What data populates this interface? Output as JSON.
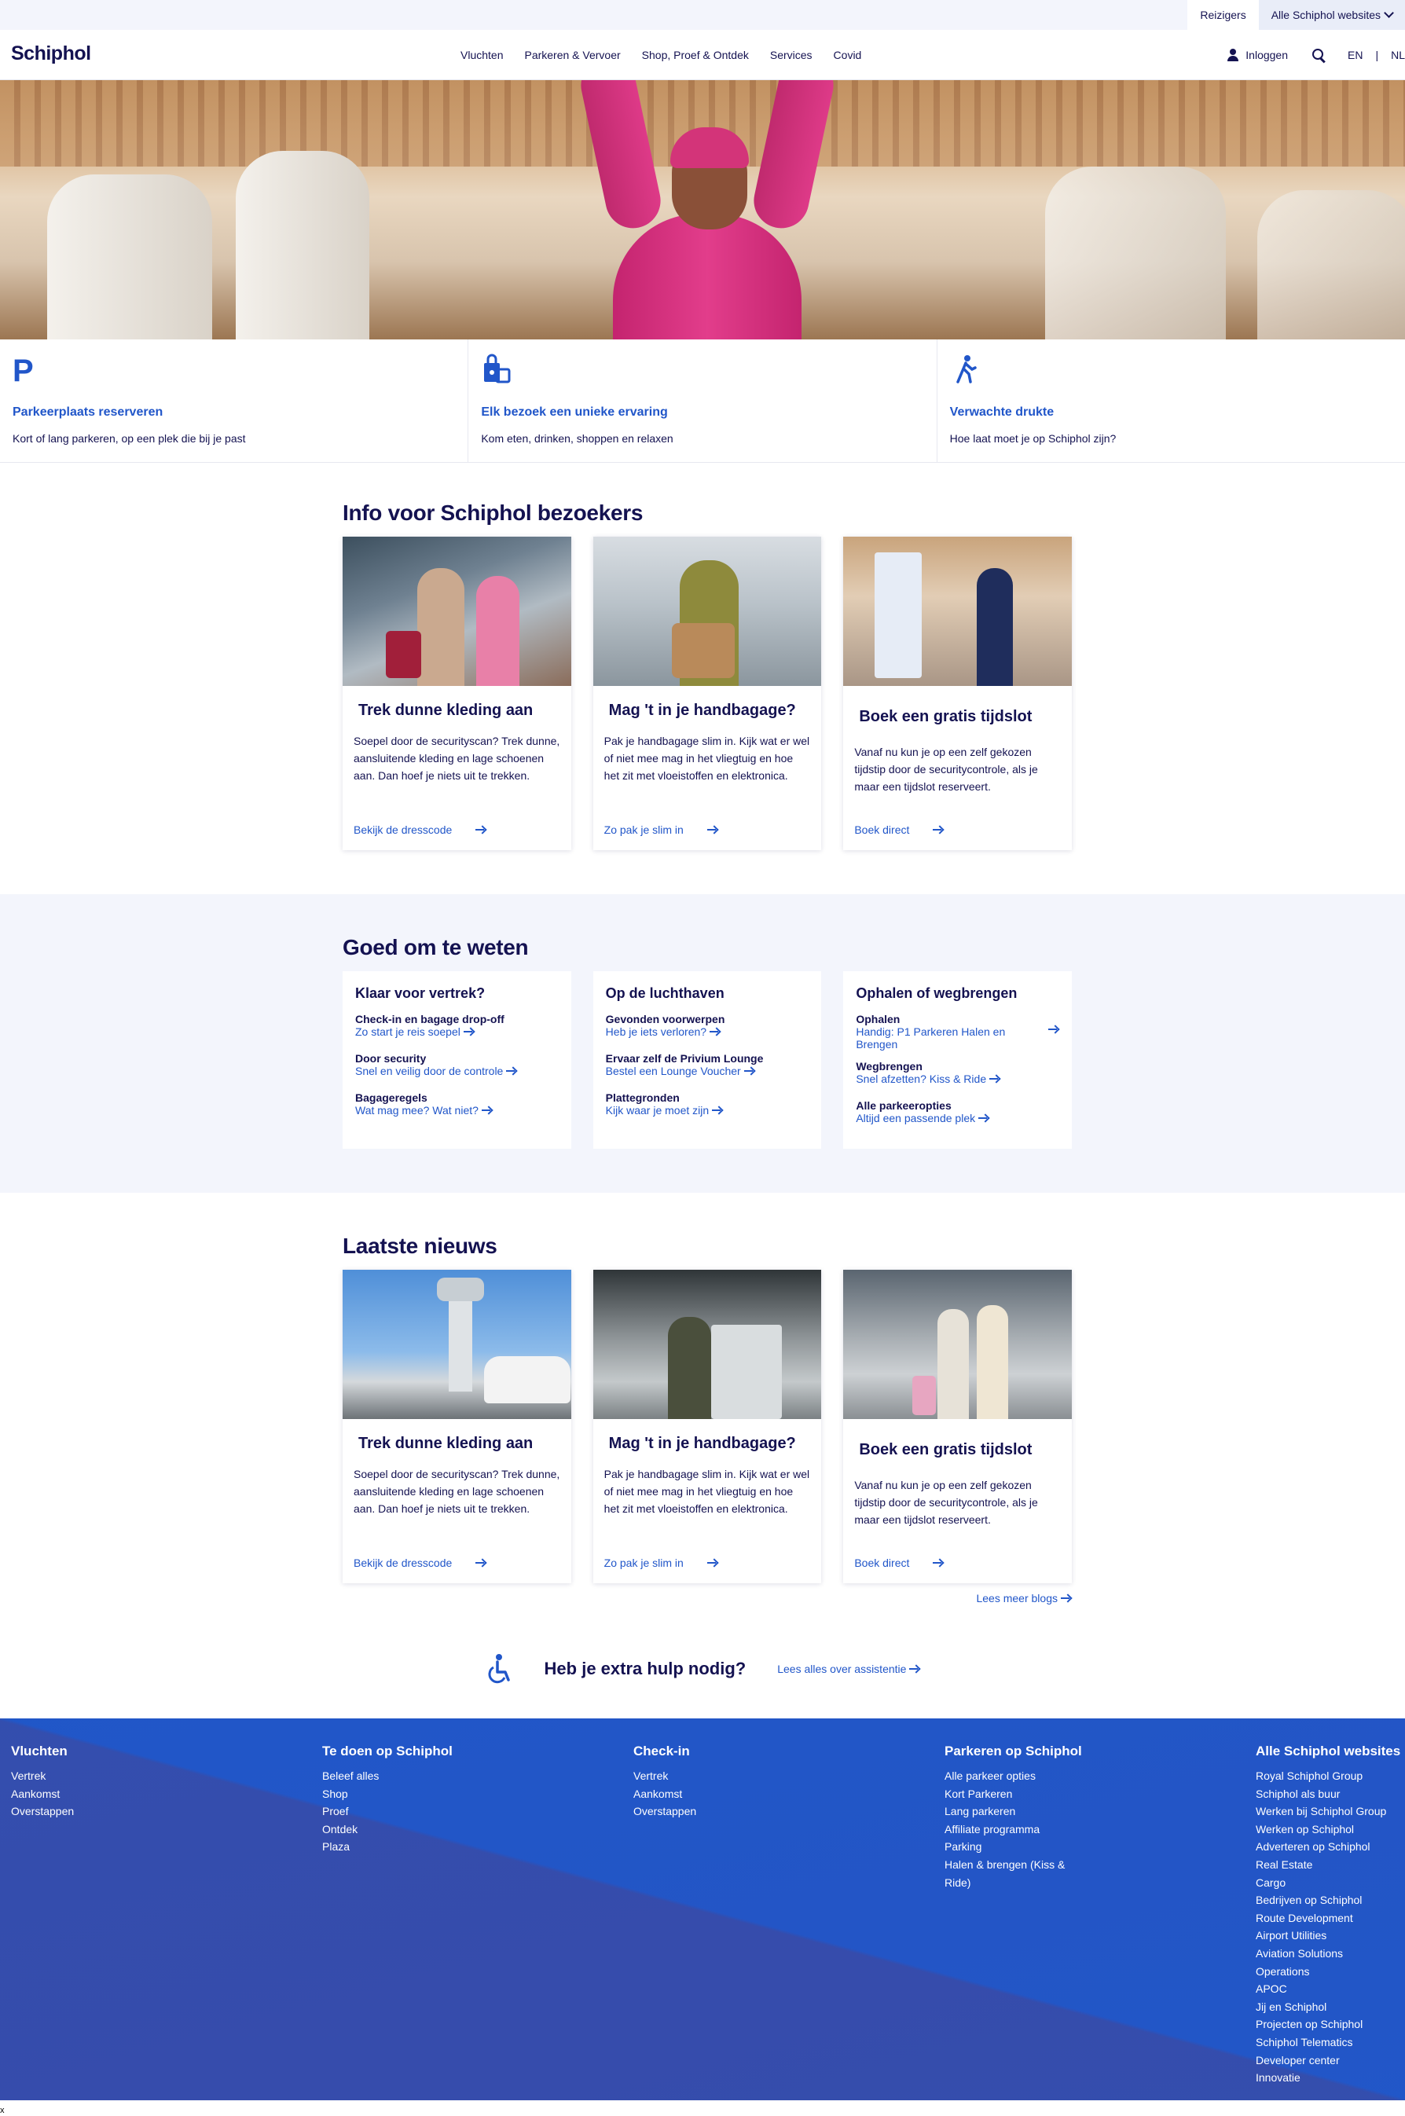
{
  "topbar": {
    "travelers": "Reizigers",
    "all_sites": "Alle Schiphol websites"
  },
  "header": {
    "logo": "Schiphol",
    "nav": [
      "Vluchten",
      "Parkeren & Vervoer",
      "Shop, Proef & Ontdek",
      "Services",
      "Covid"
    ],
    "login": "Inloggen",
    "lang_en": "EN",
    "lang_sep": "|",
    "lang_nl": "NL"
  },
  "tiles": [
    {
      "icon": "parking-icon",
      "title": "Parkeerplaats reserveren",
      "text": "Kort of lang parkeren, op een plek die bij je past"
    },
    {
      "icon": "shopping-bags-icon",
      "title": "Elk bezoek een unieke ervaring",
      "text": "Kom eten, drinken, shoppen en relaxen"
    },
    {
      "icon": "walking-person-icon",
      "title": "Verwachte drukte",
      "text": "Hoe laat moet je op Schiphol zijn?"
    }
  ],
  "info": {
    "title": "Info voor Schiphol bezoekers",
    "cards": [
      {
        "title": "Trek dunne kleding aan",
        "text": "Soepel door de securityscan? Trek dunne, aansluitende kleding en lage schoenen aan. Dan hoef je niets uit te trekken.",
        "link": "Bekijk de dresscode"
      },
      {
        "title": "Mag 't in je handbagage?",
        "text": "Pak je handbagage slim in. Kijk wat er wel of niet mee mag in het vliegtuig en hoe het zit met vloeistoffen en elektronica.",
        "link": "Zo pak je slim in"
      },
      {
        "title": "Boek een gratis tijdslot",
        "text": "Vanaf nu kun je op een zelf gekozen tijdstip door de securitycontrole, als je maar een tijdslot reserveert.",
        "link": "Boek direct"
      }
    ]
  },
  "good": {
    "title": "Goed om te weten",
    "cards": [
      {
        "title": "Klaar voor vertrek?",
        "items": [
          {
            "label": "Check-in en bagage drop-off",
            "link": "Zo start je reis soepel"
          },
          {
            "label": "Door security",
            "link": "Snel en veilig door de controle"
          },
          {
            "label": "Bagageregels",
            "link": "Wat mag mee? Wat niet?"
          }
        ]
      },
      {
        "title": "Op de luchthaven",
        "items": [
          {
            "label": "Gevonden voorwerpen",
            "link": "Heb je iets verloren?"
          },
          {
            "label": "Ervaar zelf de Privium Lounge",
            "link": "Bestel een Lounge Voucher"
          },
          {
            "label": "Plattegronden",
            "link": "Kijk waar je moet zijn"
          }
        ]
      },
      {
        "title": "Ophalen of wegbrengen",
        "items": [
          {
            "label": "Ophalen",
            "link": "Handig: P1 Parkeren Halen en Brengen"
          },
          {
            "label": "Wegbrengen",
            "link": "Snel afzetten? Kiss & Ride"
          },
          {
            "label": "Alle parkeeropties",
            "link": "Altijd een passende plek"
          }
        ]
      }
    ]
  },
  "news": {
    "title": "Laatste nieuws",
    "cards": [
      {
        "title": "Trek dunne kleding aan",
        "text": "Soepel door de securityscan? Trek dunne, aansluitende kleding en lage schoenen aan. Dan hoef je niets uit te trekken.",
        "link": "Bekijk de dresscode"
      },
      {
        "title": "Mag 't in je handbagage?",
        "text": "Pak je handbagage slim in. Kijk wat er wel of niet mee mag in het vliegtuig en hoe het zit met vloeistoffen en elektronica.",
        "link": "Zo pak je slim in"
      },
      {
        "title": "Boek een gratis tijdslot",
        "text": "Vanaf nu kun je op een zelf gekozen tijdstip door de securitycontrole, als je maar een tijdslot reserveert.",
        "link": "Boek direct"
      }
    ],
    "more": "Lees meer blogs"
  },
  "help": {
    "title": "Heb je extra hulp nodig?",
    "link": "Lees alles over assistentie"
  },
  "footer": [
    {
      "title": "Vluchten",
      "links": [
        "Vertrek",
        "Aankomst",
        "Overstappen"
      ]
    },
    {
      "title": "Te doen op Schiphol",
      "links": [
        "Beleef alles",
        "Shop",
        "Proef",
        "Ontdek",
        "Plaza"
      ]
    },
    {
      "title": "Check-in",
      "links": [
        "Vertrek",
        "Aankomst",
        "Overstappen"
      ]
    },
    {
      "title": "Parkeren op Schiphol",
      "links": [
        "Alle parkeer opties",
        "Kort Parkeren",
        "Lang parkeren",
        "Affiliate programma",
        "Parking",
        "Halen & brengen (Kiss & Ride)"
      ]
    },
    {
      "title": "Alle Schiphol websites",
      "links": [
        "Royal Schiphol Group",
        "Schiphol als buur",
        "Werken bij Schiphol Group",
        "Werken op Schiphol",
        "Adverteren op Schiphol",
        "Real Estate",
        "Cargo",
        "Bedrijven op Schiphol",
        "Route Development",
        "Airport Utilities",
        "Aviation Solutions",
        "Operations",
        "APOC",
        "Jij en Schiphol",
        "Projecten op Schiphol",
        "Schiphol Telematics",
        "Developer center",
        "Innovatie"
      ]
    }
  ],
  "corner_mark": "x"
}
